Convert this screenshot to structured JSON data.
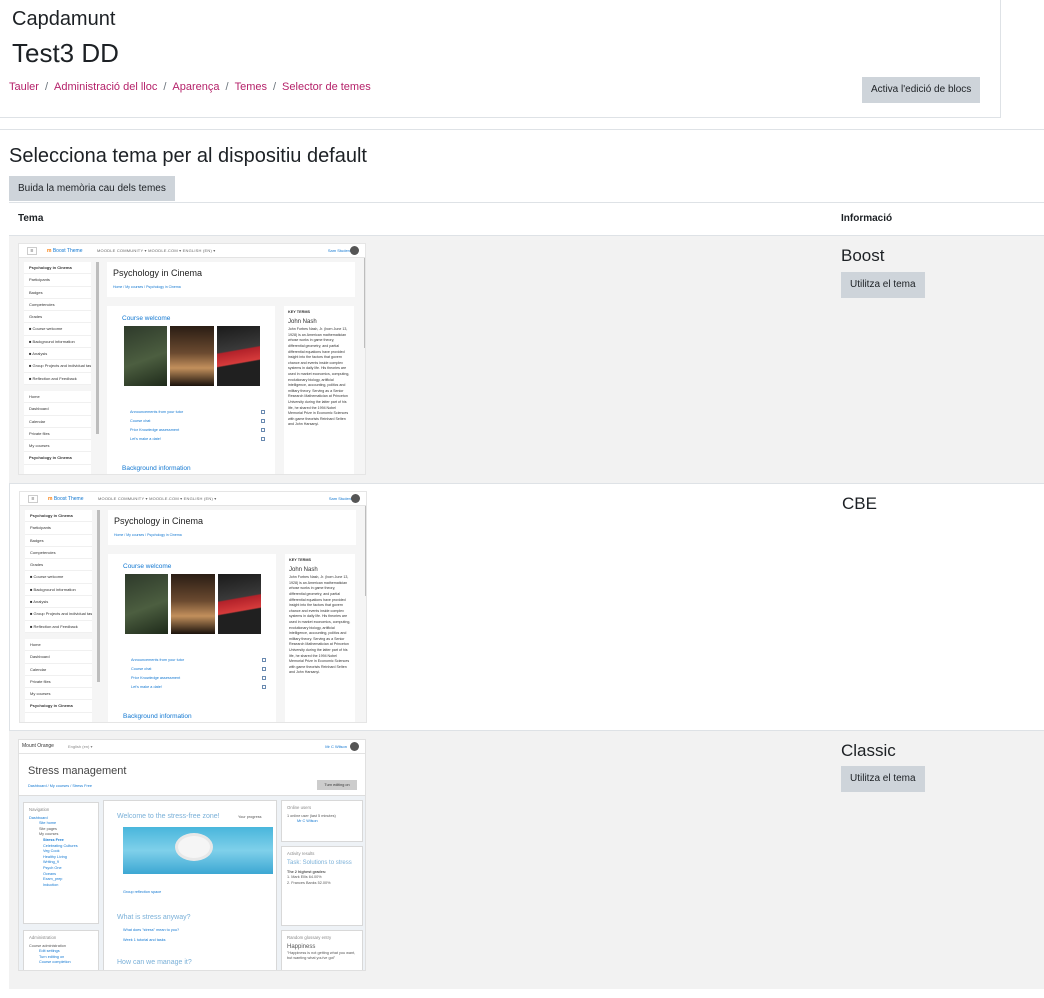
{
  "header": {
    "site_name": "Capdamunt",
    "course_title": "Test3 DD",
    "breadcrumb": [
      "Tauler",
      "Administració del lloc",
      "Aparença",
      "Temes",
      "Selector de temes"
    ],
    "edit_blocks_label": "Activa l'edició de blocs"
  },
  "main": {
    "heading": "Selecciona tema per al dispositiu default",
    "clear_cache_label": "Buida la memòria cau dels temes",
    "columns": {
      "theme": "Tema",
      "info": "Informació"
    }
  },
  "themes": [
    {
      "name": "Boost",
      "button": "Utilitza el tema",
      "current": false
    },
    {
      "name": "CBE",
      "button": "",
      "current": true
    },
    {
      "name": "Classic",
      "button": "Utilitza el tema",
      "current": false
    }
  ],
  "preview_boost": {
    "nav_brand_prefix": "m",
    "nav_brand": "Boost Theme",
    "nav_menu": "MOODLE COMMUNITY ▾   MOODLE.COM ▾   ENGLISH (EN) ▾",
    "nav_user": "Sam Student",
    "drawer_items": [
      "Psychology in Cinema",
      "Participants",
      "Badges",
      "Competencies",
      "Grades",
      "■ Course welcome",
      "■ Background information",
      "■ Analysis",
      "■ Group Projects and individual tasks",
      "■ Reflection and Feedback",
      "",
      "Home",
      "Dashboard",
      "Calendar",
      "Private files",
      "My courses",
      "Psychology in Cinema"
    ],
    "course_title": "Psychology in Cinema",
    "course_breadcrumb": "Home  /  My courses  /  Psychology in Cinema",
    "section_welcome": "Course welcome",
    "section_background": "Background information",
    "activities": [
      "Announcements from your tutor",
      "Course chat",
      "Prior Knowledge assessment",
      "Let's make a date!"
    ],
    "terms_heading": "KEY TERMS",
    "terms_name": "John Nash",
    "terms_text": "John Forbes Nash, Jr. (born June 13, 1928) is an American mathematician whose works in game theory, differential geometry, and partial differential equations have provided insight into the factors that govern chance and events inside complex systems in daily life. His theories are used in market economics, computing, evolutionary biology, artificial intelligence, accounting, politics and military theory. Serving as a Senior Research Mathematician at Princeton University during the latter part of his life, he shared the 1994 Nobel Memorial Prize in Economic Sciences with game theorists Reinhard Selten and John Harsanyi.",
    "terms_add": "Add a new entry",
    "terms_view": "View all entries"
  },
  "preview_classic": {
    "brand": "Mount Orange",
    "lang": "English (en) ▾",
    "user": "Mr C Wilson",
    "title": "Stress management",
    "breadcrumb": "Dashboard  /  My courses  /  Stress Free",
    "turn_editing": "Turn editing on",
    "nav_heading": "Navigation",
    "nav_items": [
      "Dashboard",
      "Site home",
      "Site pages",
      "My courses",
      "Stress Free",
      "Celebrating Cultures",
      "Veg Cook",
      "Healthy Living",
      "Writing_9",
      "Psych One",
      "Oceans",
      "Exam_prep",
      "Induction"
    ],
    "admin_heading": "Administration",
    "admin_items": [
      "Course administration",
      "Edit settings",
      "Turn editing on",
      "Course completion"
    ],
    "welcome": "Welcome to the stress-free zone!",
    "progress": "Your progress",
    "activity1": "Group reflection space",
    "stress_heading": "What is stress anyway?",
    "activity2": "What does \"stress\" mean to you?",
    "activity3": "Week 1 tutorial and tasks",
    "manage_heading": "How can we manage it?",
    "online_heading": "Online users",
    "online_text": "1 online user (last 5 minutes)",
    "online_user": "Mr C Wilson",
    "results_heading": "Activity results",
    "results_title": "Task: Solutions to stress",
    "results_sub": "The 2 highest grades:",
    "results": [
      "1.  Mark Ellis        64.00%",
      "2.  Frances Banks   52.00%"
    ],
    "glossary_heading": "Random glossary entry",
    "glossary_title": "Happiness",
    "glossary_text": "\"Happiness is not getting what you want, but wanting what you've got\""
  }
}
